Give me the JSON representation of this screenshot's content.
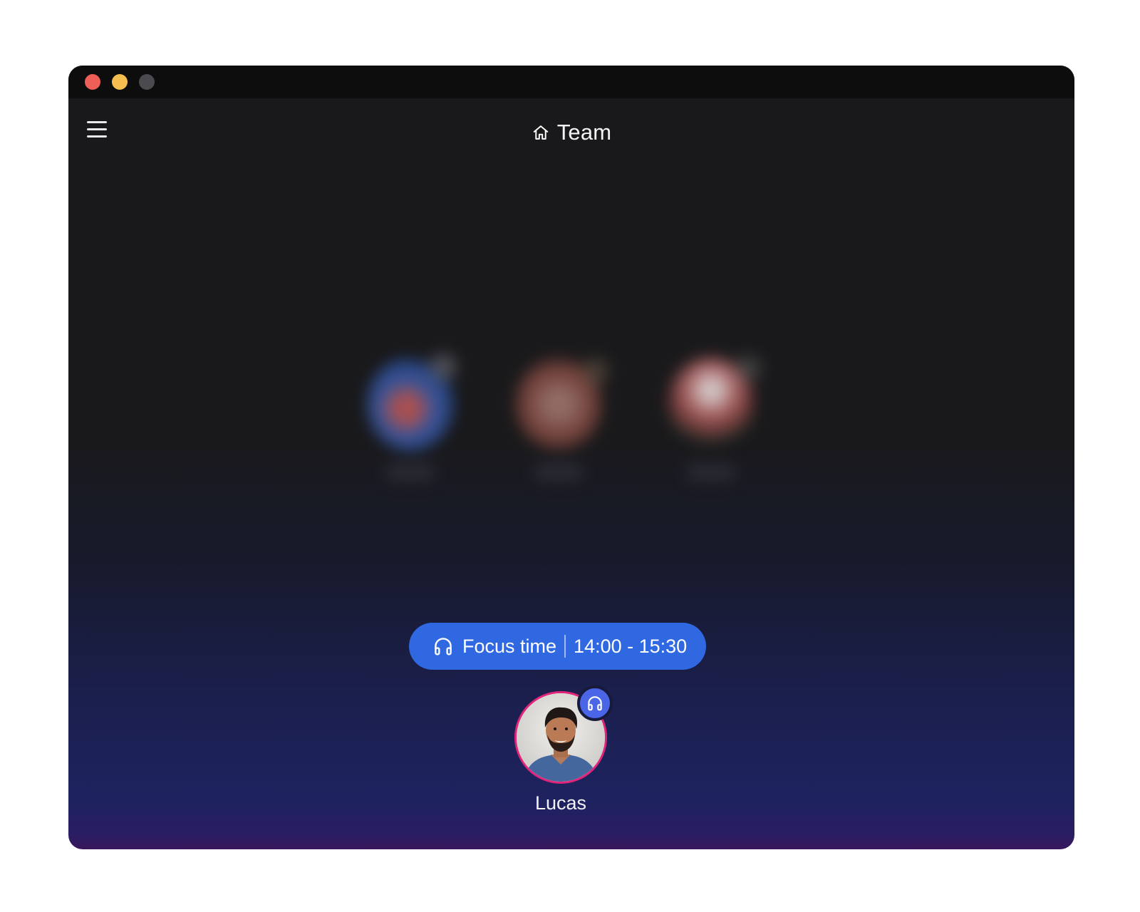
{
  "window": {
    "title_bar": {
      "buttons": [
        "close",
        "minimize",
        "zoom"
      ],
      "colors": {
        "close": "#ed5f57",
        "minimize": "#f6be4f",
        "zoom": "#4b4b4f"
      }
    }
  },
  "header": {
    "menu_icon": "hamburger-menu-icon",
    "title_icon": "home-icon",
    "title": "Team"
  },
  "focus_status": {
    "icon": "headphones-icon",
    "label": "Focus time",
    "time_range": "14:00 - 15:30",
    "color": "#2f68e0"
  },
  "current_user": {
    "name": "Lucas",
    "ring_color": "#e0247a",
    "badge_icon": "headphones-icon",
    "badge_color": "#4a66e6"
  },
  "background_members": {
    "count_visible": 3,
    "blurred": true
  }
}
